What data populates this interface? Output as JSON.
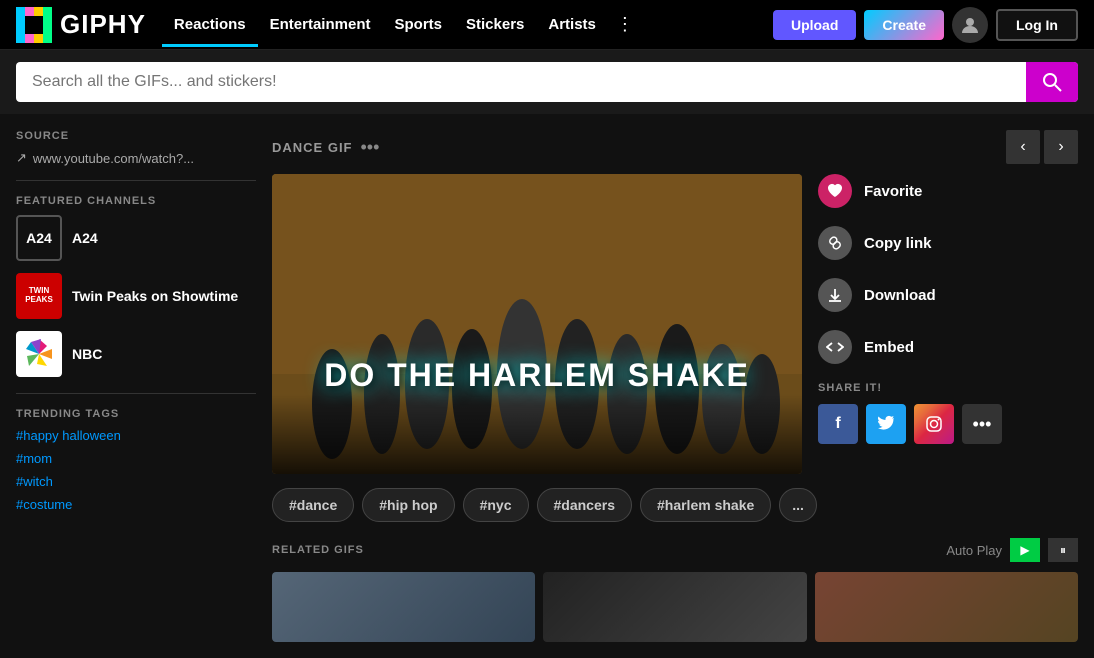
{
  "header": {
    "logo_text": "GIPHY",
    "nav_items": [
      {
        "label": "Reactions",
        "key": "reactions",
        "active": true
      },
      {
        "label": "Entertainment",
        "key": "entertainment",
        "active": false
      },
      {
        "label": "Sports",
        "key": "sports",
        "active": false
      },
      {
        "label": "Stickers",
        "key": "stickers",
        "active": false
      },
      {
        "label": "Artists",
        "key": "artists",
        "active": false
      }
    ],
    "upload_label": "Upload",
    "create_label": "Create",
    "login_label": "Log In"
  },
  "search": {
    "placeholder": "Search all the GIFs... and stickers!"
  },
  "sidebar": {
    "source_label": "SOURCE",
    "source_url": "www.youtube.com/watch?...",
    "featured_channels_label": "FEATURED CHANNELS",
    "channels": [
      {
        "name": "A24",
        "key": "a24",
        "display": "A24"
      },
      {
        "name": "Twin Peaks on Showtime",
        "key": "twin-peaks",
        "display": "TWIN\nPEAKS"
      },
      {
        "name": "NBC",
        "key": "nbc",
        "display": "NBC"
      }
    ],
    "trending_tags_label": "TRENDING TAGS",
    "tags": [
      "#happy halloween",
      "#mom",
      "#witch",
      "#costume"
    ]
  },
  "gif_detail": {
    "label": "DANCE GIF",
    "title": "DO THE HARLEM SHAKE",
    "actions": [
      {
        "key": "favorite",
        "label": "Favorite"
      },
      {
        "key": "copy",
        "label": "Copy link"
      },
      {
        "key": "download",
        "label": "Download"
      },
      {
        "key": "embed",
        "label": "Embed"
      }
    ],
    "share_label": "SHARE IT!",
    "share_buttons": [
      {
        "key": "facebook",
        "label": "f"
      },
      {
        "key": "twitter",
        "label": "🐦"
      },
      {
        "key": "instagram",
        "label": "📷"
      },
      {
        "key": "more",
        "label": "•••"
      }
    ],
    "tags": [
      {
        "label": "#dance",
        "key": "dance"
      },
      {
        "label": "#hip hop",
        "key": "hip-hop"
      },
      {
        "label": "#nyc",
        "key": "nyc"
      },
      {
        "label": "#dancers",
        "key": "dancers"
      },
      {
        "label": "#harlem shake",
        "key": "harlem-shake"
      },
      {
        "label": "...",
        "key": "more"
      }
    ]
  },
  "related": {
    "label": "RELATED GIFS",
    "autoplay_label": "Auto Play"
  },
  "icons": {
    "search": "🔍",
    "heart": "♥",
    "link": "🔗",
    "download": "⬇",
    "embed": "< >",
    "facebook": "f",
    "twitter": "t",
    "instagram": "in",
    "more_dots": "•••",
    "prev": "‹",
    "next": "›",
    "play": "▶",
    "pause": "⏸",
    "link_source": "↗"
  }
}
